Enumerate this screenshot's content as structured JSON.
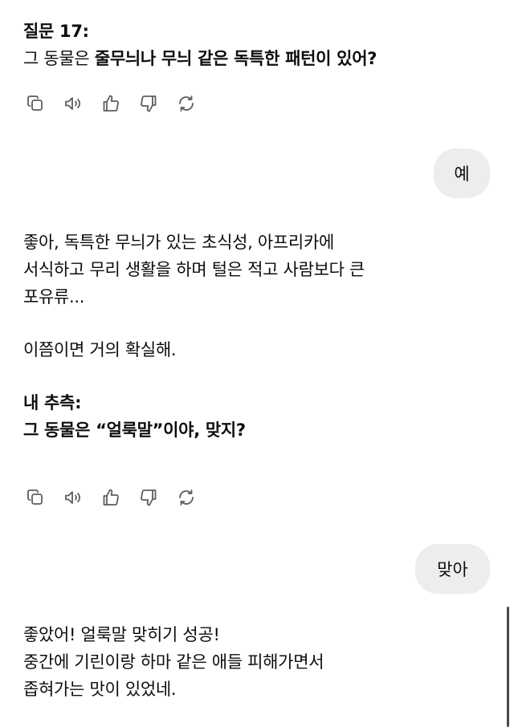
{
  "messages": {
    "m1": {
      "line1": "질문 17:",
      "line2_prefix": "그 동물은 ",
      "line2_bold": "줄무늬나 무늬 같은 독특한 패턴이 있어?"
    },
    "u1": "예",
    "m2": {
      "line1": "좋아, 독특한 무늬가 있는 초식성, 아프리카에",
      "line2": "서식하고 무리 생활을 하며 털은 적고 사람보다 큰",
      "line3": "포유류...",
      "line4": "이쯤이면 거의 확실해.",
      "line5": "내 추측:",
      "line6": "그 동물은 “얼룩말”이야, 맞지?"
    },
    "u2": "맞아",
    "m3": {
      "line1": "좋았어! 얼룩말 맞히기 성공!",
      "line2": "중간에 기린이랑 하마 같은 애들 피해가면서",
      "line3": "좁혀가는 맛이 있었네."
    }
  },
  "actions": [
    {
      "name": "copy-icon"
    },
    {
      "name": "speaker-icon"
    },
    {
      "name": "thumbs-up-icon"
    },
    {
      "name": "thumbs-down-icon"
    },
    {
      "name": "regenerate-icon"
    }
  ],
  "colors": {
    "bubble_bg": "#ededed",
    "icon": "#5d5d5d",
    "text": "#0d0d0d"
  }
}
